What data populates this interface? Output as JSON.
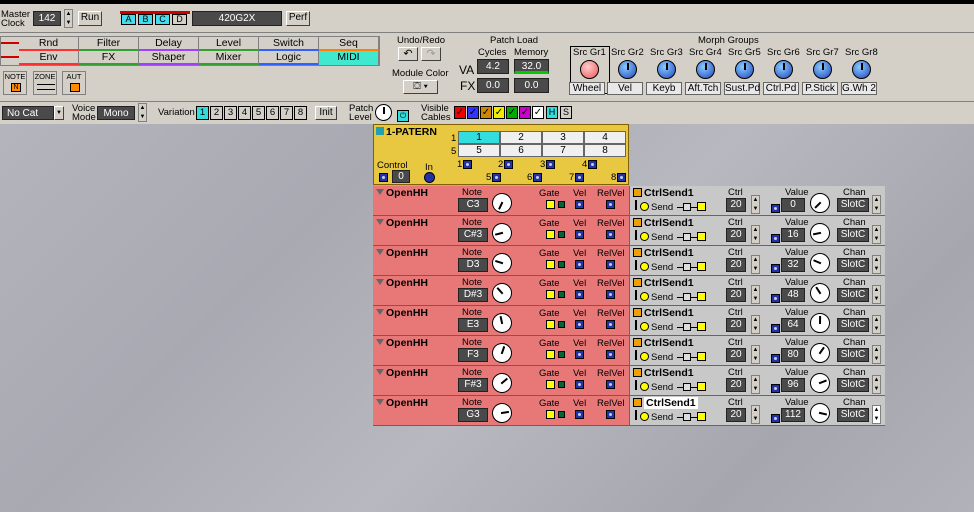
{
  "header": {
    "master_clock_label": "Master\nClock",
    "tempo": "142",
    "run": "Run",
    "slots": [
      "A",
      "B",
      "C",
      "D"
    ],
    "patch_name": "420G2X",
    "perf": "Perf"
  },
  "tabs_row1": [
    "Rnd",
    "Filter",
    "Delay",
    "Level",
    "Switch",
    "Seq"
  ],
  "tabs_row2": [
    "Env",
    "FX",
    "Shaper",
    "Mixer",
    "Logic",
    "MIDI"
  ],
  "tab_colors": [
    "#ff3030",
    "#30a030",
    "#a040ff",
    "#30a030",
    "#3060ff",
    "#ff8000"
  ],
  "icons": [
    "NOTE",
    "ZONE",
    "AUT"
  ],
  "undo": {
    "title": "Undo/Redo"
  },
  "module_color": "Module Color",
  "patch_load": {
    "title": "Patch Load",
    "cycles": "Cycles",
    "memory": "Memory",
    "va": "VA",
    "fx": "FX",
    "va_cycles": "4.2",
    "va_mem": "32.0",
    "fx_cycles": "0.0",
    "fx_mem": "0.0"
  },
  "morph": {
    "title": "Morph Groups",
    "groups": [
      "Src Gr1",
      "Src Gr2",
      "Src Gr3",
      "Src Gr4",
      "Src Gr5",
      "Src Gr6",
      "Src Gr7",
      "Src Gr8"
    ],
    "names": [
      "Wheel",
      "Vel",
      "Keyb",
      "Aft.Tch",
      "Sust.Pd",
      "Ctrl.Pd",
      "P.Stick",
      "G.Wh 2"
    ]
  },
  "toolbar2": {
    "category": "No Cat",
    "voice_mode_label": "Voice\nMode",
    "voice_mode": "Mono",
    "variation_label": "Variation",
    "variations": [
      "1",
      "2",
      "3",
      "4",
      "5",
      "6",
      "7",
      "8"
    ],
    "init": "Init",
    "patch_level": "Patch\nLevel",
    "visible_cables": "Visible\nCables",
    "h": "H",
    "s": "S"
  },
  "pattern": {
    "title": "1-PATERN",
    "cells": [
      "1",
      "2",
      "3",
      "4",
      "5",
      "6",
      "7",
      "8"
    ],
    "row_labels": [
      "1",
      "5"
    ],
    "control_label": "Control",
    "control_value": "0",
    "in_label": "In",
    "ports": [
      "1",
      "2",
      "3",
      "4",
      "5",
      "6",
      "7",
      "8"
    ]
  },
  "labels": {
    "note": "Note",
    "gate": "Gate",
    "vel": "Vel",
    "relvel": "RelVel",
    "ctrl": "Ctrl",
    "value": "Value",
    "chan": "Chan",
    "send": "Send"
  },
  "rows": [
    {
      "name": "OpenHH",
      "note": "C3",
      "ctrl_name": "CtrlSend1",
      "ctrl": "20",
      "value": "0",
      "chan": "SlotC"
    },
    {
      "name": "OpenHH",
      "note": "C#3",
      "ctrl_name": "CtrlSend1",
      "ctrl": "20",
      "value": "16",
      "chan": "SlotC"
    },
    {
      "name": "OpenHH",
      "note": "D3",
      "ctrl_name": "CtrlSend1",
      "ctrl": "20",
      "value": "32",
      "chan": "SlotC"
    },
    {
      "name": "OpenHH",
      "note": "D#3",
      "ctrl_name": "CtrlSend1",
      "ctrl": "20",
      "value": "48",
      "chan": "SlotC"
    },
    {
      "name": "OpenHH",
      "note": "E3",
      "ctrl_name": "CtrlSend1",
      "ctrl": "20",
      "value": "64",
      "chan": "SlotC"
    },
    {
      "name": "OpenHH",
      "note": "F3",
      "ctrl_name": "CtrlSend1",
      "ctrl": "20",
      "value": "80",
      "chan": "SlotC"
    },
    {
      "name": "OpenHH",
      "note": "F#3",
      "ctrl_name": "CtrlSend1",
      "ctrl": "20",
      "value": "96",
      "chan": "SlotC"
    },
    {
      "name": "OpenHH",
      "note": "G3",
      "ctrl_name": "CtrlSend1",
      "ctrl": "20",
      "value": "112",
      "chan": "SlotC"
    }
  ]
}
